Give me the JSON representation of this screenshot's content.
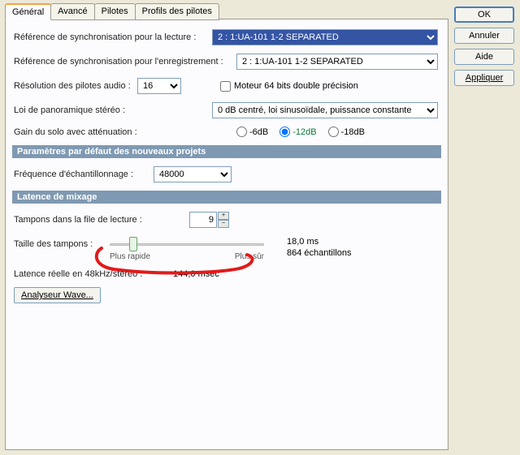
{
  "buttons": {
    "ok": "OK",
    "cancel": "Annuler",
    "help": "Aide",
    "apply": "Appliquer"
  },
  "tabs": {
    "general": "Général",
    "advanced": "Avancé",
    "drivers": "Pilotes",
    "profiles": "Profils des pilotes"
  },
  "labels": {
    "playback_ref": "Référence de synchronisation pour la lecture :",
    "record_ref": "Référence de synchronisation pour l'enregistrement :",
    "driver_res": "Résolution des pilotes audio :",
    "engine64": "Moteur 64 bits double précision",
    "pan_law": "Loi de panoramique stéréo :",
    "solo_gain": "Gain du solo avec atténuation :",
    "section_defaults": "Paramètres par défaut des nouveaux projets",
    "sample_rate": "Fréquence d'échantillonnage :",
    "section_latency": "Latence de mixage",
    "queue_buffers": "Tampons dans la file de lecture :",
    "buffer_size": "Taille des tampons :",
    "faster": "Plus rapide",
    "safer": "Plus sûr",
    "latency_ms": "18,0 ms",
    "latency_samples": "864 échantillons",
    "real_latency_lbl": "Latence réelle en 48kHz/stéréo :",
    "real_latency_val": "144,0 msec",
    "wave_analyzer": "Analyseur Wave..."
  },
  "values": {
    "playback_ref": "2 : 1:UA-101 1-2 SEPARATED",
    "record_ref": "2 : 1:UA-101 1-2 SEPARATED",
    "driver_res": "16",
    "pan_law": "0 dB centré, loi sinusoïdale, puissance constante",
    "sample_rate": "48000",
    "queue_buffers": "9"
  },
  "radios": {
    "r1": "-6dB",
    "r2": "-12dB",
    "r3": "-18dB"
  }
}
